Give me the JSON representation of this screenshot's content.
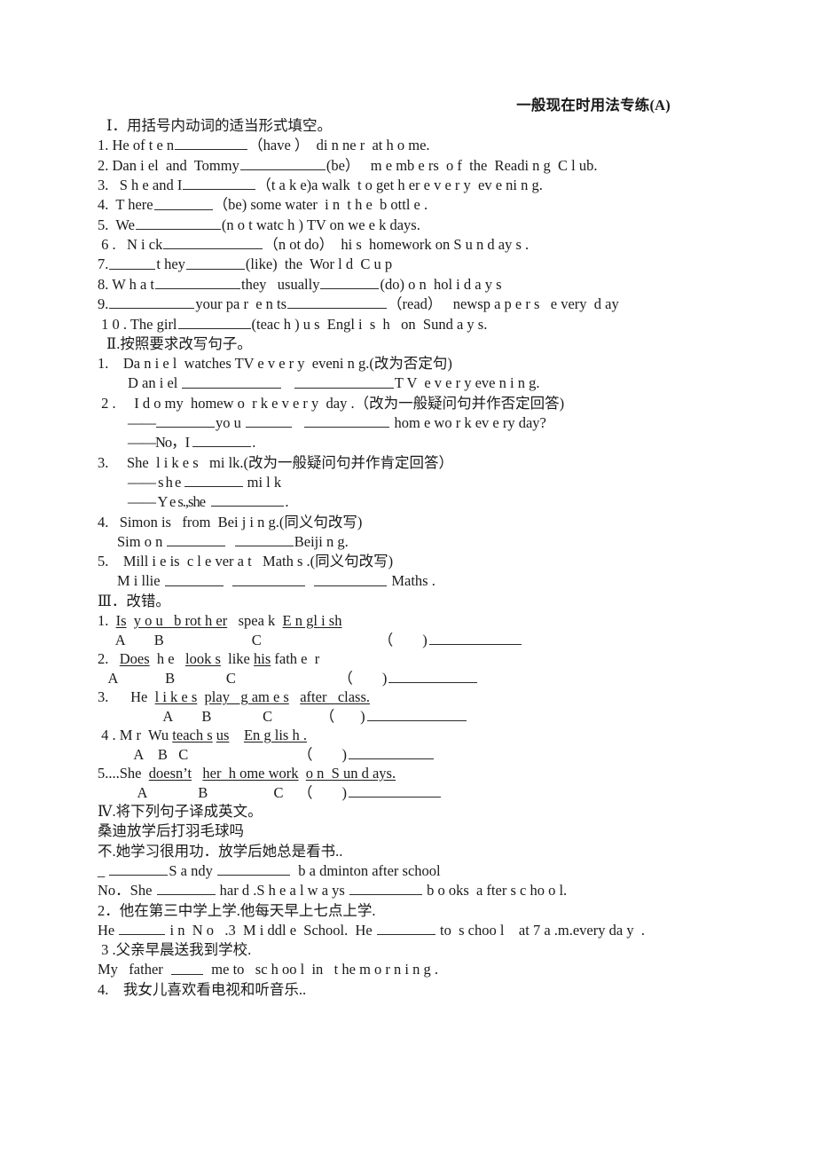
{
  "document": {
    "title": "一般现在时用法专练(A)",
    "sections": [
      {
        "id": "section-1",
        "heading": "Ⅰ．用括号内动词的适当形式填空。",
        "items": [
          {
            "id": "s1-q1",
            "text_before": "1. He of t e n",
            "blank": "b-lg",
            "text_after": "（have ）  di n ne r  at h o me."
          },
          {
            "id": "s1-q2",
            "text_before": "2. Dan i el  and  Tommy",
            "blank": "b-xl",
            "text_after": "(be）   m e mb e rs  o f  the  Readi n g  C l ub."
          },
          {
            "id": "s1-q3",
            "text_before": "3.   S h e and I",
            "blank": "b-lg",
            "text_after": "（t a k e)a walk  t o get h er e v e r y  ev e ni n g."
          },
          {
            "id": "s1-q4",
            "text_before": "4.  T here",
            "blank": "b-md",
            "text_after": "（be) some water  i n  t h e  b ottl e ."
          },
          {
            "id": "s1-q5",
            "text_before": "5.  We",
            "blank": "b-xl",
            "text_after": "(n o t watc h ) TV on we e k days."
          },
          {
            "id": "s1-q6",
            "text_before": " 6 .   N i ck",
            "blank": "b-xxl",
            "text_after": "（n ot do）  hi s  homework on S u n d ay s ."
          },
          {
            "id": "s1-q7",
            "text_before": "7.",
            "blank": "b-sm",
            "text_mid": "t hey",
            "blank2": "b-md",
            "text_after": "(like)  the  Wor l d  C u p"
          },
          {
            "id": "s1-q8",
            "text_before": "8. W h a t",
            "blank": "b-xl",
            "text_mid": "they   usually",
            "blank2": "b-md",
            "text_after": "(do) o n  hol i d a y s"
          },
          {
            "id": "s1-q9",
            "text_before": "9.",
            "blank": "b-xl",
            "text_mid": "your pa r  e n ts",
            "blank2": "b-xxl",
            "text_after": "（read）   newsp a p e r s   e very  d ay"
          },
          {
            "id": "s1-q10",
            "text_before": " 1 0 . The girl",
            "blank": "b-lg",
            "text_after": "(teac h ) u s  Engl i  s  h   on  Sund a y s."
          }
        ]
      },
      {
        "id": "section-2",
        "heading": "Ⅱ.按照要求改写句子。",
        "items": [
          {
            "id": "s2-q1",
            "prompt": "1.    Da n i e l  watches TV e v e r y  eveni n g.(改为否定句)",
            "answer_lines": [
              {
                "id": "s2-q1-a",
                "pre": "D an i el ",
                "blanks": [
                  "b-xxl",
                  "b-xxl"
                ],
                "post": "T V  e v e r y eve n i n g."
              }
            ]
          },
          {
            "id": "s2-q2",
            "prompt": " 2 .     I d o my  homew o  r k e v e r y  day .（改为一般疑问句并作否定回答)",
            "answer_lines": [
              {
                "id": "s2-q2-a",
                "pre": "——",
                "blanks": [
                  "b-md"
                ],
                "mid": "yo u ",
                "blanks2": [
                  "b-sm",
                  "b-xl"
                ],
                "post": " hom e wo r k ev e ry day?"
              },
              {
                "id": "s2-q2-b",
                "pre": "——No，I ",
                "blanks": [
                  "b-md"
                ],
                "post": "."
              }
            ]
          },
          {
            "id": "s2-q3",
            "prompt": "3.     She  l i k e s   mi lk.(改为一般疑问句并作肯定回答）",
            "answer_lines": [
              {
                "id": "s2-q3-a",
                "pre": "—— s h e ",
                "blanks": [
                  "b-md"
                ],
                "post": " mi l k"
              },
              {
                "id": "s2-q3-b",
                "pre": "—— Y e s.,she  ",
                "blanks": [
                  "b-lg"
                ],
                "post": "."
              }
            ]
          },
          {
            "id": "s2-q4",
            "prompt": "4.   Simon is   from  Bei j i n g.(同义句改写)",
            "answer_lines": [
              {
                "id": "s2-q4-a",
                "pre": "Sim o n ",
                "blanks": [
                  "b-md",
                  "b-md"
                ],
                "post": "Beiji n g."
              }
            ]
          },
          {
            "id": "s2-q5",
            "prompt": "5.    Mill i e is  c l e ver a t   Math s .(同义句改写)",
            "answer_lines": [
              {
                "id": "s2-q5-a",
                "pre": "M i llie ",
                "blanks": [
                  "b-md",
                  "b-lg",
                  "b-lg"
                ],
                "post": " Maths ."
              }
            ]
          }
        ]
      },
      {
        "id": "section-3",
        "heading": "Ⅲ．改错。",
        "items": [
          {
            "id": "s3-q1",
            "number": "1.",
            "parts": [
              {
                "text": "  ",
                "underline": false
              },
              {
                "text": "Is",
                "underline": true
              },
              {
                "text": "  ",
                "underline": false
              },
              {
                "text": "y o u   b rot h er",
                "underline": true
              },
              {
                "text": "   spea k  ",
                "underline": false
              },
              {
                "text": "E n gl i sh",
                "underline": true
              }
            ],
            "markers": "     A        B                        C                                （        )",
            "answer_rule": "a-1"
          },
          {
            "id": "s3-q2",
            "number": "2.",
            "parts": [
              {
                "text": "   ",
                "underline": false
              },
              {
                "text": "Does",
                "underline": true
              },
              {
                "text": "  h e   ",
                "underline": false
              },
              {
                "text": "look s",
                "underline": true
              },
              {
                "text": "  like ",
                "underline": false
              },
              {
                "text": "his",
                "underline": true
              },
              {
                "text": " fath e  r",
                "underline": false
              }
            ],
            "markers": "   A             B              C                            （        )",
            "answer_rule": "a-2"
          },
          {
            "id": "s3-q3",
            "number": "3.",
            "parts": [
              {
                "text": "      He  ",
                "underline": false
              },
              {
                "text": "l i k e s",
                "underline": true
              },
              {
                "text": "  ",
                "underline": false
              },
              {
                "text": "play   g am e s",
                "underline": true
              },
              {
                "text": "   ",
                "underline": false
              },
              {
                "text": "after   class.",
                "underline": true
              }
            ],
            "markers": "                  A        B              C             （       )",
            "answer_rule": "a-3"
          },
          {
            "id": "s3-q4",
            "number": " 4 .",
            "parts": [
              {
                "text": " M r  Wu ",
                "underline": false
              },
              {
                "text": "teach s",
                "underline": true
              },
              {
                "text": " ",
                "underline": false
              },
              {
                "text": "us",
                "underline": true
              },
              {
                "text": "    ",
                "underline": false
              },
              {
                "text": "En g lis h .",
                "underline": true
              }
            ],
            "markers": "          A    B   C                              （        )",
            "answer_rule": "a-4"
          },
          {
            "id": "s3-q5",
            "number": "5....She",
            "parts": [
              {
                "text": "  ",
                "underline": false
              },
              {
                "text": "doesn’t",
                "underline": true
              },
              {
                "text": "   ",
                "underline": false
              },
              {
                "text": "her  h ome work",
                "underline": true
              },
              {
                "text": "  ",
                "underline": false
              },
              {
                "text": "o n  S un d ays.",
                "underline": true
              }
            ],
            "markers": "           A              B                  C    （        )",
            "answer_rule": "a-5"
          }
        ]
      },
      {
        "id": "section-4",
        "heading": "Ⅳ.将下列句子译成英文。",
        "items": [
          {
            "id": "s4-q1-cn1",
            "type": "cn",
            "text": "桑迪放学后打羽毛球吗"
          },
          {
            "id": "s4-q1-cn2",
            "type": "cn",
            "text": "不.她学习很用功．放学后她总是看书.."
          },
          {
            "id": "s4-q1-en1",
            "type": "en",
            "pre": "_ ",
            "blanks": [
              "b-md"
            ],
            "mid": "S a ndy ",
            "blanks2": [
              "b-lg"
            ],
            "post": "  b a dminton after school"
          },
          {
            "id": "s4-q1-en2",
            "type": "en",
            "pre": "No．She ",
            "blanks": [
              "b-md"
            ],
            "mid": " har d .S h e a l w a ys ",
            "blanks2": [
              "b-lg"
            ],
            "post": " b o oks  a fter s c ho o l."
          },
          {
            "id": "s4-q2-cn",
            "type": "cn",
            "text": "2．他在第三中学上学.他每天早上七点上学."
          },
          {
            "id": "s4-q2-en1",
            "type": "en",
            "pre": "He ",
            "blanks": [
              "b-sm"
            ],
            "mid": " i n  N o   .3  M i ddl e  School.  He ",
            "blanks2": [
              "b-md"
            ],
            "post": " to  s choo l    at 7 a .m.every da y  ."
          },
          {
            "id": "s4-q3-cn",
            "type": "cn",
            "text": " 3 .父亲早晨送我到学校."
          },
          {
            "id": "s4-q3-en",
            "type": "en",
            "pre": "My   father  ",
            "blanks": [
              "b-xs"
            ],
            "mid": "",
            "blanks2": [],
            "post": "  me to   sc h oo l  in   t he m o r n i n g ."
          },
          {
            "id": "s4-q4-cn",
            "type": "cn",
            "text": "4.    我女儿喜欢看电视和听音乐.."
          }
        ]
      }
    ]
  }
}
